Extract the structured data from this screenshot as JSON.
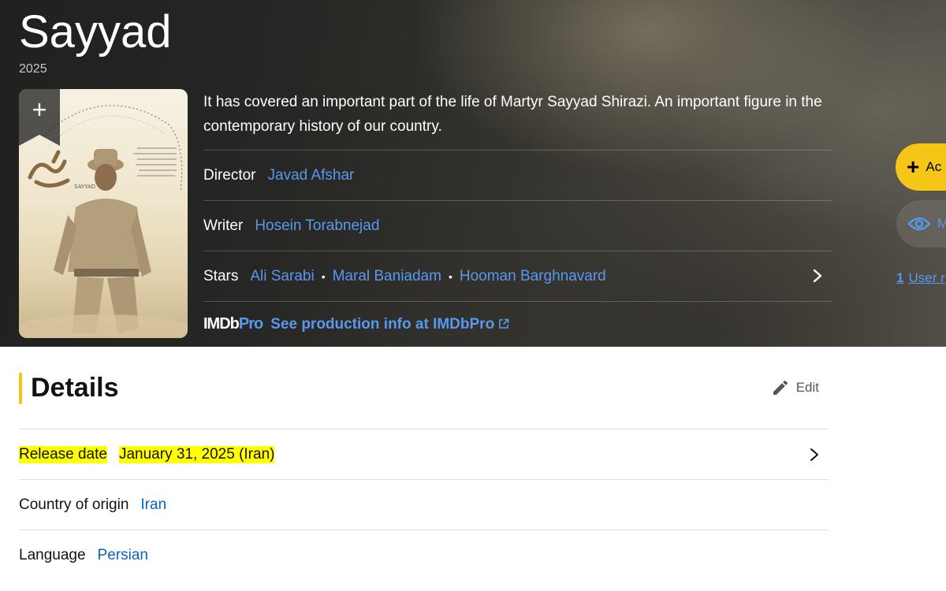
{
  "title": "Sayyad",
  "year": "2025",
  "poster": {
    "alt_lettering": "SAYYAD"
  },
  "plot": "It has covered an important part of the life of Martyr Sayyad Shirazi. An important figure in the contemporary history of our country.",
  "credits": {
    "director": {
      "label": "Director",
      "names": [
        "Javad Afshar"
      ]
    },
    "writer": {
      "label": "Writer",
      "names": [
        "Hosein Torabnejad"
      ]
    },
    "stars": {
      "label": "Stars",
      "names": [
        "Ali Sarabi",
        "Maral Baniadam",
        "Hooman Barghnavard"
      ]
    }
  },
  "imdbpro": {
    "logo_imdb": "IMDb",
    "logo_pro": "Pro",
    "link_text": "See production info at IMDbPro"
  },
  "side_actions": {
    "watchlist_label": "Ac",
    "watched_label": "M",
    "user_reviews_count": "1",
    "user_reviews_label": "User r"
  },
  "details": {
    "heading": "Details",
    "edit_label": "Edit",
    "release_date": {
      "label": "Release date",
      "value": "January 31, 2025 (Iran)"
    },
    "country": {
      "label": "Country of origin",
      "value": "Iran"
    },
    "language": {
      "label": "Language",
      "value": "Persian"
    }
  },
  "colors": {
    "accent": "#f5c518",
    "link_dark": "#5799ef",
    "link_light": "#0e63be",
    "highlight": "#ffff00"
  }
}
